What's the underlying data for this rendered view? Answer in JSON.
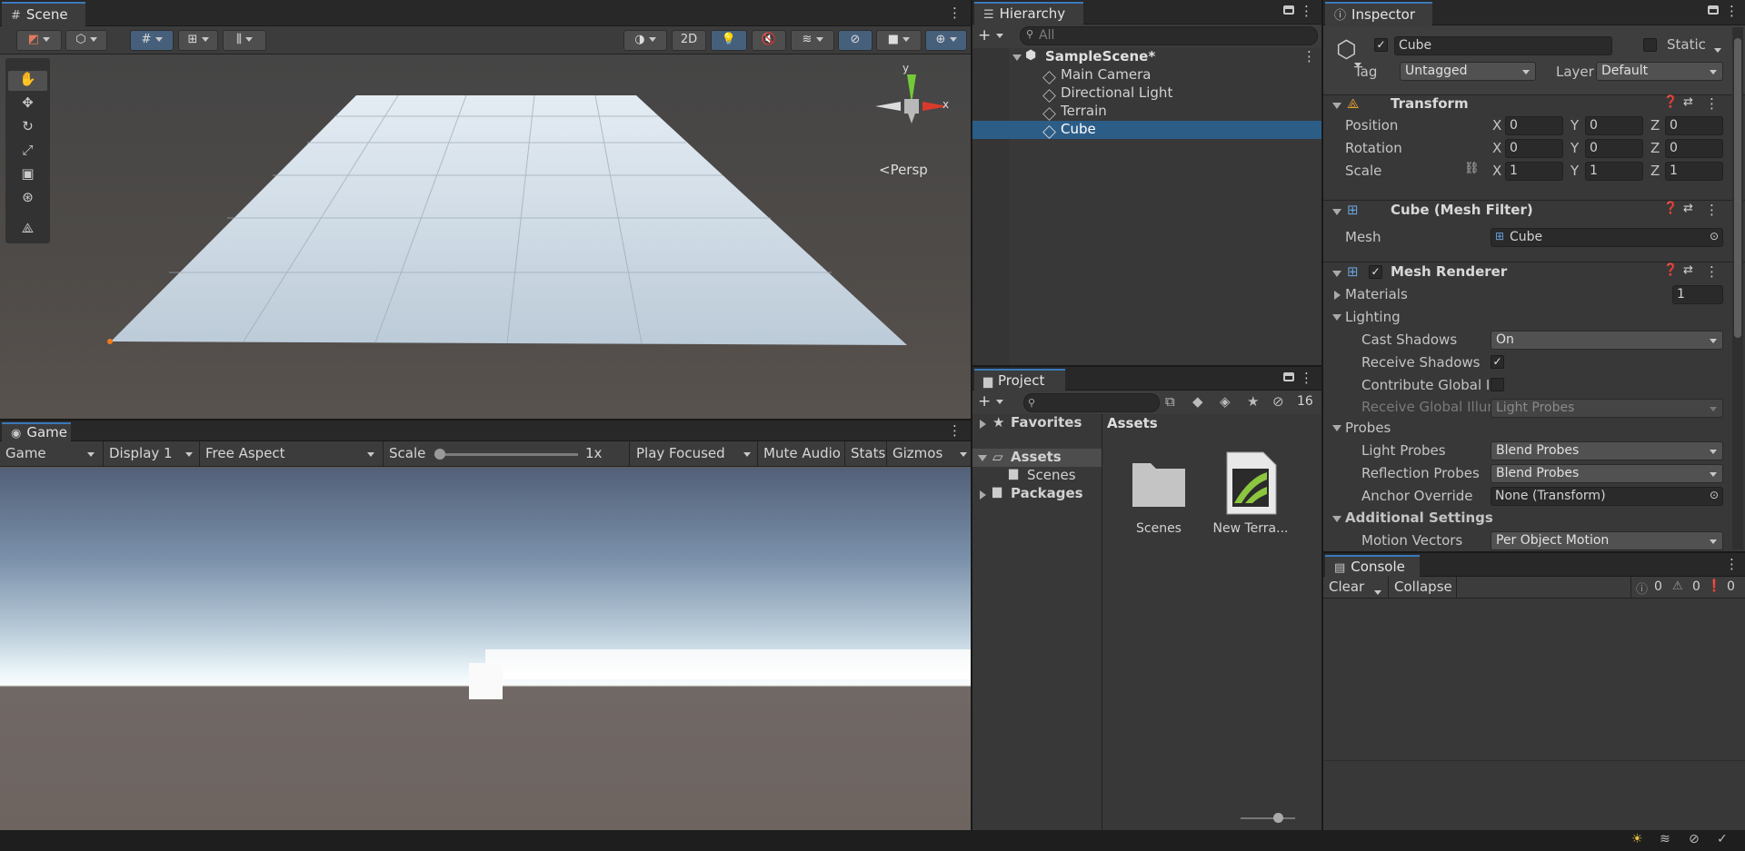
{
  "scene": {
    "tab": "Scene",
    "toolbar": {
      "btn_2d": "2D"
    },
    "gizmo": {
      "axis_y": "y",
      "axis_x": "x",
      "persp": "<Persp"
    }
  },
  "game": {
    "tab": "Game",
    "toolbar": {
      "mode": "Game",
      "display": "Display 1",
      "aspect": "Free Aspect",
      "scale_label": "Scale",
      "scale_value": "1x",
      "play_focused": "Play Focused",
      "mute_audio": "Mute Audio",
      "stats": "Stats",
      "gizmos": "Gizmos"
    }
  },
  "hierarchy": {
    "tab": "Hierarchy",
    "search_placeholder": "All",
    "scene": "SampleScene*",
    "items": [
      "Main Camera",
      "Directional Light",
      "Terrain",
      "Cube"
    ],
    "selected": "Cube"
  },
  "project": {
    "tab": "Project",
    "hidden_count": "16",
    "tree": {
      "favorites": "Favorites",
      "assets": "Assets",
      "scenes": "Scenes",
      "packages": "Packages"
    },
    "breadcrumb": "Assets",
    "assets": [
      {
        "name": "Scenes",
        "icon": "folder-icon"
      },
      {
        "name": "New Terra...",
        "icon": "terrain-asset-icon"
      }
    ]
  },
  "inspector": {
    "tab": "Inspector",
    "object_name": "Cube",
    "static_label": "Static",
    "tag_label": "Tag",
    "tag_value": "Untagged",
    "layer_label": "Layer",
    "layer_value": "Default",
    "transform": {
      "title": "Transform",
      "position_label": "Position",
      "position": {
        "x": "0",
        "y": "0",
        "z": "0"
      },
      "rotation_label": "Rotation",
      "rotation": {
        "x": "0",
        "y": "0",
        "z": "0"
      },
      "scale_label": "Scale",
      "scale": {
        "x": "1",
        "y": "1",
        "z": "1"
      }
    },
    "axis": {
      "x": "X",
      "y": "Y",
      "z": "Z"
    },
    "mesh_filter": {
      "title": "Cube (Mesh Filter)",
      "mesh_label": "Mesh",
      "mesh_value": "Cube"
    },
    "mesh_renderer": {
      "title": "Mesh Renderer",
      "materials_label": "Materials",
      "materials_count": "1",
      "lighting": "Lighting",
      "cast_shadows_label": "Cast Shadows",
      "cast_shadows_value": "On",
      "receive_shadows_label": "Receive Shadows",
      "contribute_gi_label": "Contribute Global Il",
      "receive_gi_label": "Receive Global Illur",
      "receive_gi_value": "Light Probes",
      "probes": "Probes",
      "light_probes_label": "Light Probes",
      "light_probes_value": "Blend Probes",
      "reflection_probes_label": "Reflection Probes",
      "reflection_probes_value": "Blend Probes",
      "anchor_override_label": "Anchor Override",
      "anchor_override_value": "None (Transform)",
      "additional_settings": "Additional Settings",
      "motion_vectors_label": "Motion Vectors",
      "motion_vectors_value": "Per Object Motion"
    }
  },
  "console": {
    "tab": "Console",
    "clear": "Clear",
    "collapse": "Collapse",
    "log_count": "0",
    "warn_count": "0",
    "error_count": "0"
  },
  "colors": {
    "accent": "#3a79bb",
    "selection": "#2c5d87",
    "panel": "#383838",
    "header": "#282828"
  }
}
